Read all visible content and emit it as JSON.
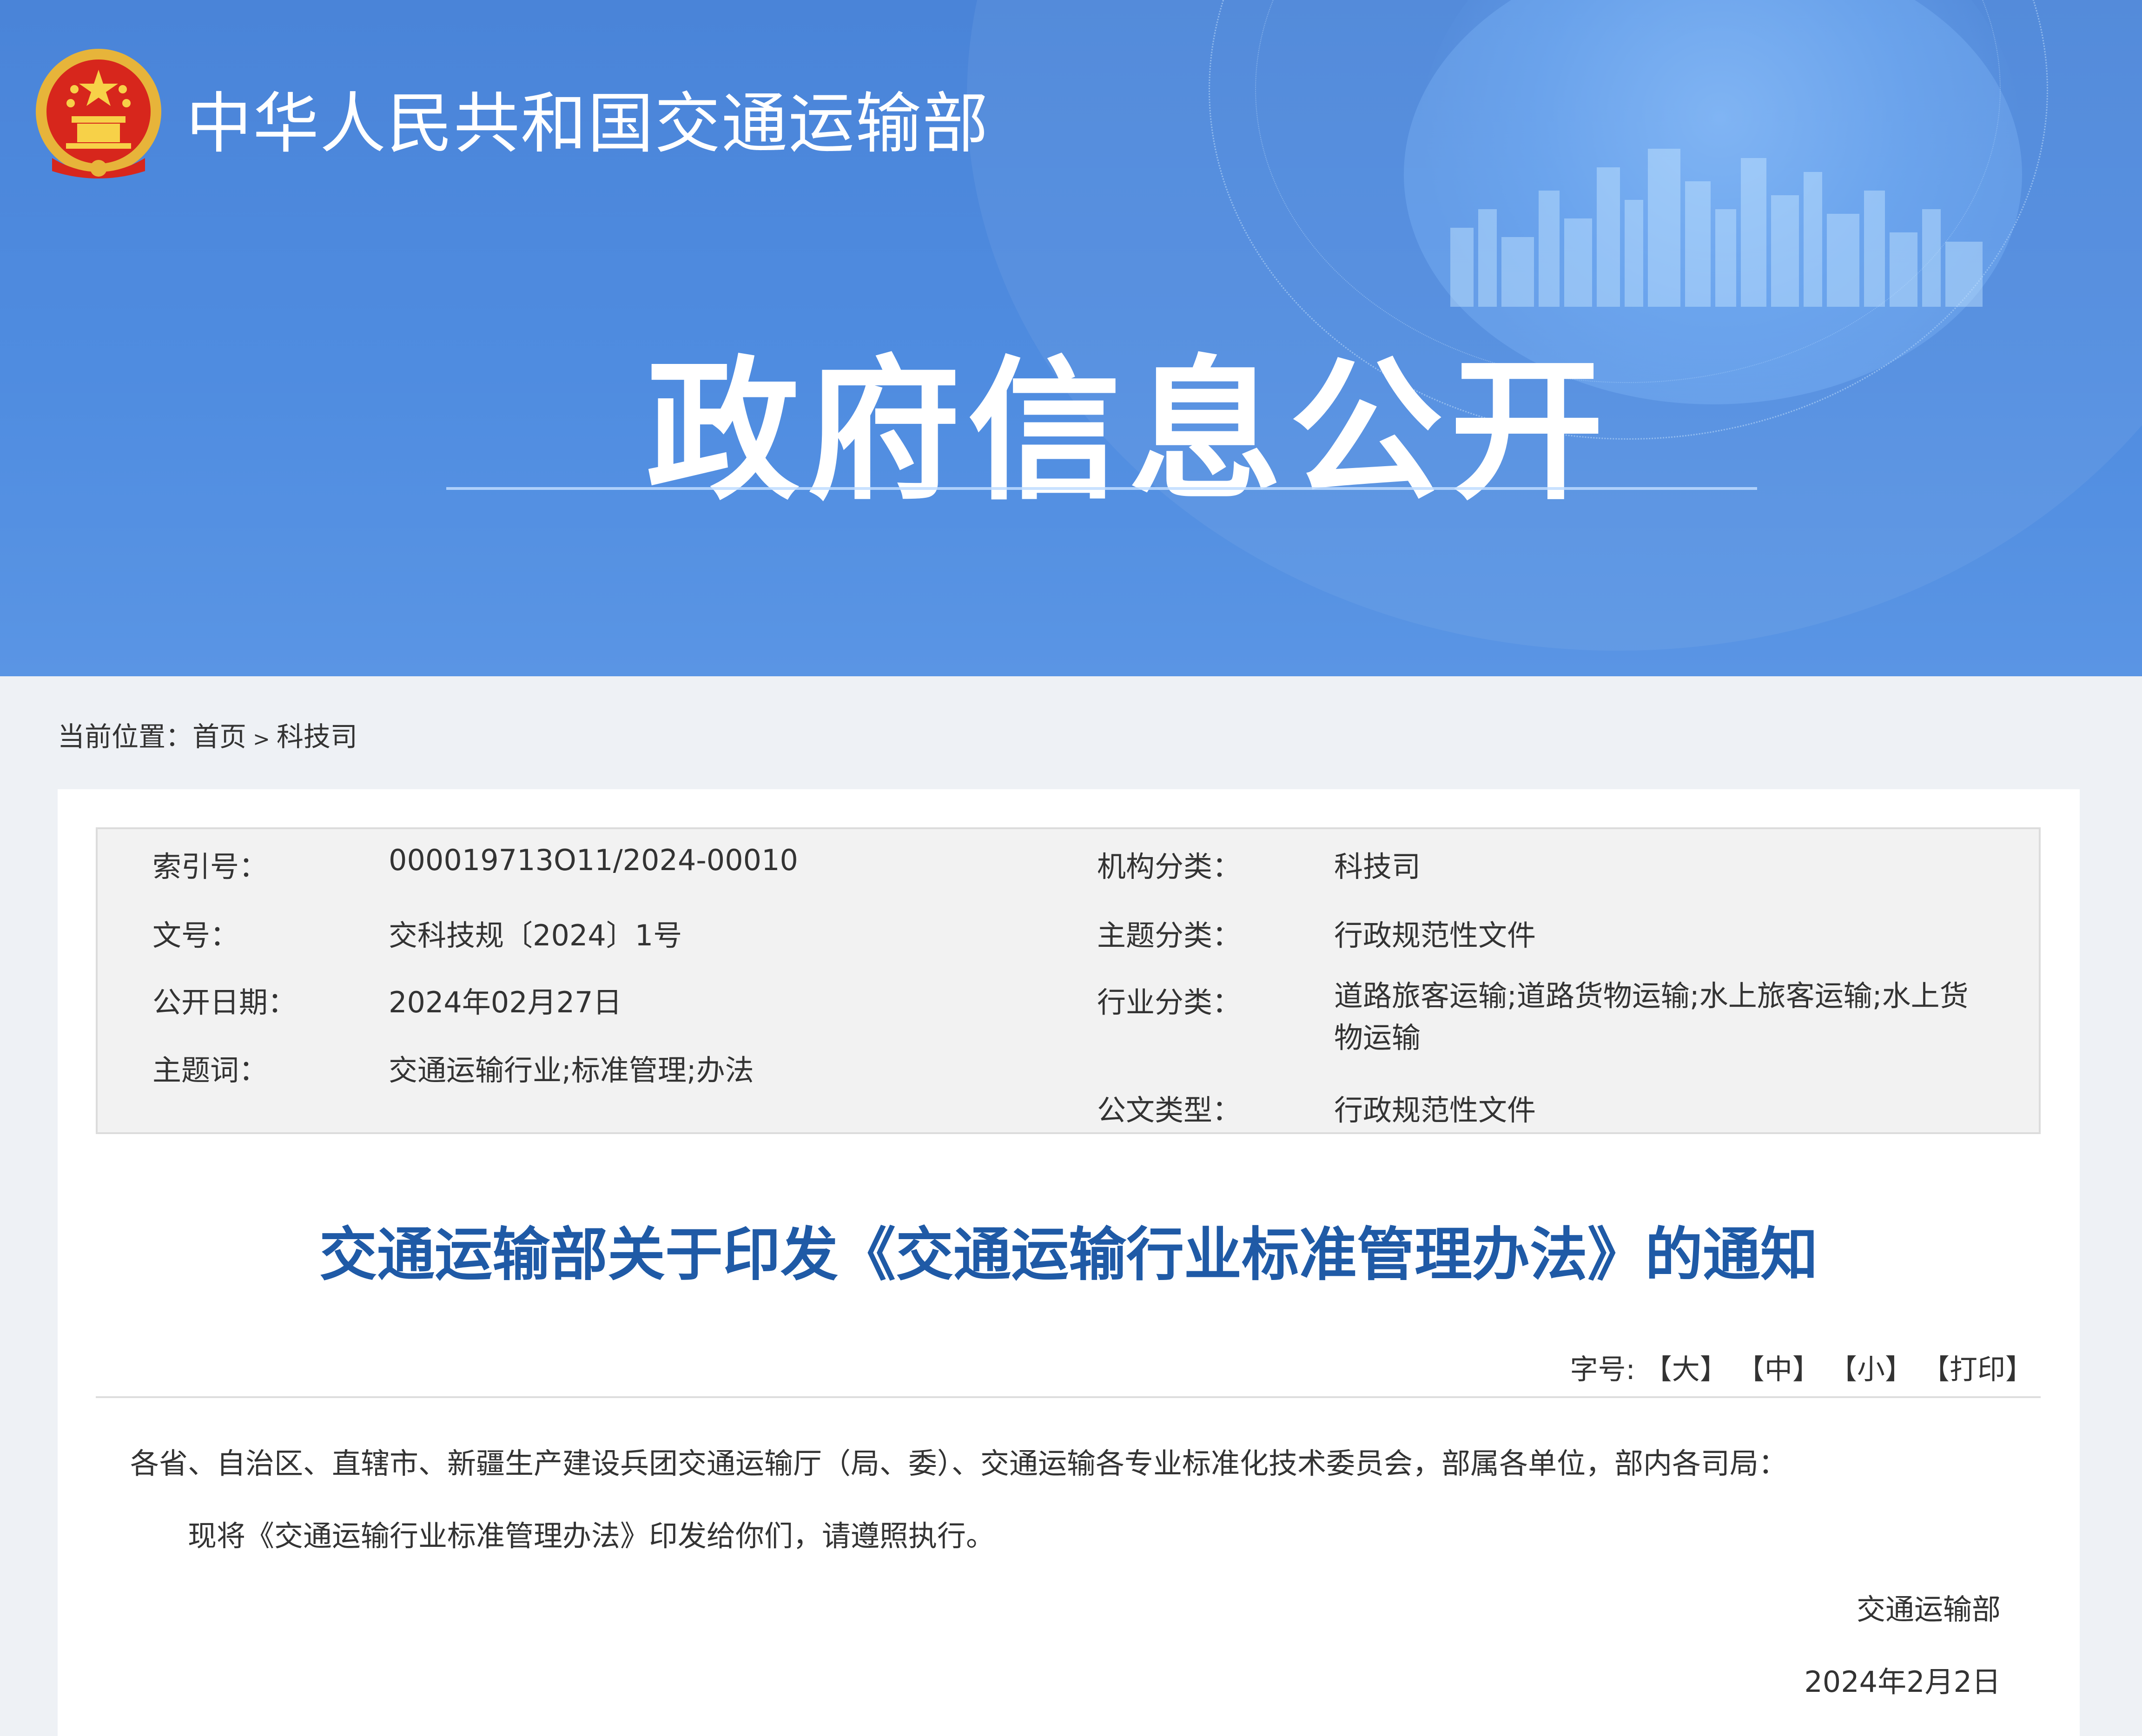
{
  "header": {
    "ministry_name": "中华人民共和国交通运输部",
    "page_title": "政府信息公开",
    "colors": {
      "banner_blue": "#4f8ce0",
      "title_blue": "#1f5aa6"
    }
  },
  "breadcrumb": {
    "prefix": "当前位置：",
    "items": [
      "首页",
      "科技司"
    ],
    "separator": ">"
  },
  "meta": {
    "index_no": {
      "label": "索引号：",
      "value": "000019713O11/2024-00010"
    },
    "doc_no": {
      "label": "文号：",
      "value": "交科技规〔2024〕1号"
    },
    "pub_date": {
      "label": "公开日期：",
      "value": "2024年02月27日"
    },
    "keywords": {
      "label": "主题词：",
      "value": "交通运输行业;标准管理;办法"
    },
    "org": {
      "label": "机构分类：",
      "value": "科技司"
    },
    "topic": {
      "label": "主题分类：",
      "value": "行政规范性文件"
    },
    "industry": {
      "label": "行业分类：",
      "value": "道路旅客运输;道路货物运输;水上旅客运输;水上货物运输"
    },
    "doc_type": {
      "label": "公文类型：",
      "value": "行政规范性文件"
    }
  },
  "article": {
    "title": "交通运输部关于印发《交通运输行业标准管理办法》的通知",
    "font_size_label": "字号:",
    "font_large": "【大】",
    "font_medium": "【中】",
    "font_small": "【小】",
    "print": "【打印】",
    "salutation": "各省、自治区、直辖市、新疆生产建设兵团交通运输厅（局、委）、交通运输各专业标准化技术委员会，部属各单位，部内各司局：",
    "body": "现将《交通运输行业标准管理办法》印发给你们，请遵照执行。",
    "signature": "交通运输部",
    "date": "2024年2月2日"
  }
}
